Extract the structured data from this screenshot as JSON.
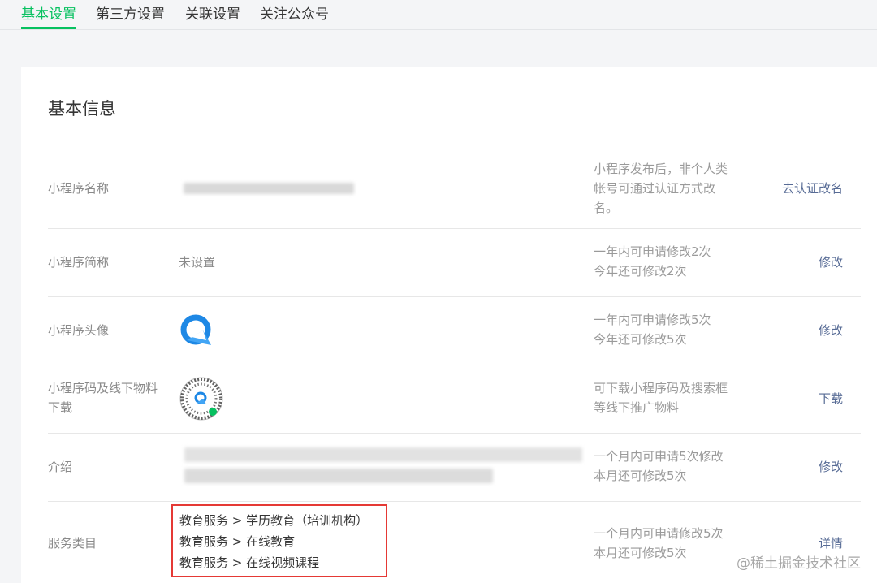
{
  "tabs": [
    {
      "label": "基本设置",
      "active": true
    },
    {
      "label": "第三方设置",
      "active": false
    },
    {
      "label": "关联设置",
      "active": false
    },
    {
      "label": "关注公众号",
      "active": false
    }
  ],
  "section_title": "基本信息",
  "rows": {
    "name": {
      "label": "小程序名称",
      "note_lines": [
        "小程序发布后，非个人类",
        "帐号可通过认证方式改",
        "名。"
      ],
      "action": "去认证改名"
    },
    "short_name": {
      "label": "小程序简称",
      "value": "未设置",
      "note_lines": [
        "一年内可申请修改2次",
        "今年还可修改2次"
      ],
      "action": "修改"
    },
    "avatar": {
      "label": "小程序头像",
      "note_lines": [
        "一年内可申请修改5次",
        "今年还可修改5次"
      ],
      "action": "修改"
    },
    "qrcode": {
      "label_lines": [
        "小程序码及线下物料",
        "下载"
      ],
      "note_lines": [
        "可下载小程序码及搜索框",
        "等线下推广物料"
      ],
      "action": "下载"
    },
    "intro": {
      "label": "介绍",
      "note_lines": [
        "一个月内可申请5次修改",
        "本月还可修改5次"
      ],
      "action": "修改"
    },
    "category": {
      "label": "服务类目",
      "items": [
        "教育服务 > 学历教育（培训机构）",
        "教育服务 > 在线教育",
        "教育服务 > 在线视频课程"
      ],
      "note_lines": [
        "一个月内可申请修改5次",
        "本月还可修改5次"
      ],
      "action": "详情"
    }
  },
  "watermark": "@稀土掘金技术社区",
  "colors": {
    "accent": "#07c160",
    "link": "#576b95",
    "highlight_box": "#e53935"
  }
}
